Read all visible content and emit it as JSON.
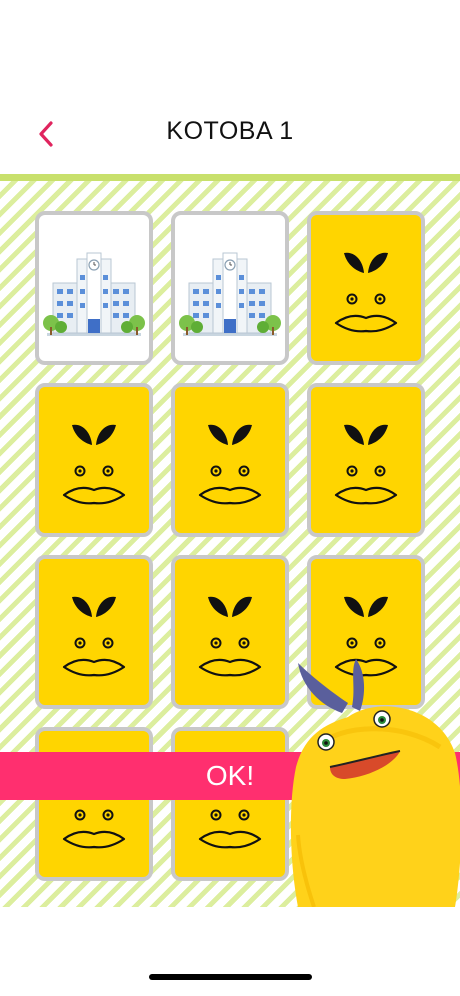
{
  "header": {
    "title": "KOTOBA 1",
    "back_icon": "chevron-left-icon"
  },
  "colors": {
    "accent": "#e0245e",
    "green_line": "#c8e06c",
    "stripe": "#dcee9e",
    "card_back": "#ffd500",
    "card_border": "#c8c8c8",
    "ok_banner": "#ff2f6f",
    "mascot": "#ffd21a"
  },
  "board": {
    "cards": [
      {
        "state": "face-up",
        "image": "school-building-icon"
      },
      {
        "state": "face-up",
        "image": "school-building-icon"
      },
      {
        "state": "face-down",
        "image": "duck-face-icon"
      },
      {
        "state": "face-down",
        "image": "duck-face-icon"
      },
      {
        "state": "face-down",
        "image": "duck-face-icon"
      },
      {
        "state": "face-down",
        "image": "duck-face-icon"
      },
      {
        "state": "face-down",
        "image": "duck-face-icon"
      },
      {
        "state": "face-down",
        "image": "duck-face-icon"
      },
      {
        "state": "face-down",
        "image": "duck-face-icon"
      },
      {
        "state": "face-down",
        "image": "duck-face-icon"
      },
      {
        "state": "face-down",
        "image": "duck-face-icon"
      }
    ]
  },
  "ok_banner": {
    "label": "OK!"
  },
  "mascot": {
    "icon": "yellow-mascot-icon"
  }
}
